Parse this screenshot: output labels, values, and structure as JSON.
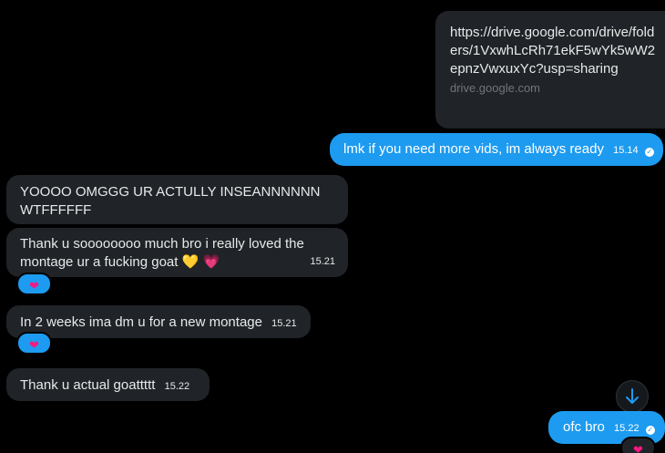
{
  "link_card": {
    "url": "https://drive.google.com/drive/folders/1VxwhLcRh71ekF5wYk5wW2epnzVwxuxYc?usp=sharing",
    "domain": "drive.google.com"
  },
  "messages": [
    {
      "text": "lmk if you need more vids, im always ready",
      "time": "15.14"
    },
    {
      "text": "YOOOO OMGGG UR ACTULLY INSEANNNNNN WTFFFFFF"
    },
    {
      "text": "Thank u soooooooo much bro i really loved the montage ur a fucking goat 💛 💗",
      "time": "15.21"
    },
    {
      "text": "In 2 weeks ima dm u for a new montage",
      "time": "15.21"
    },
    {
      "text": "Thank u actual goattttt",
      "time": "15.22"
    },
    {
      "text": "ofc bro",
      "time": "15.22"
    }
  ],
  "reactions": [
    "❤",
    "❤",
    "❤"
  ],
  "icons": {
    "sent": "check-circle-icon",
    "scroll": "arrow-down-icon"
  },
  "colors": {
    "background": "#000000",
    "incoming_bubble": "#202327",
    "outgoing_bubble": "#1d9bf0",
    "reaction_heart": "#f91880"
  }
}
